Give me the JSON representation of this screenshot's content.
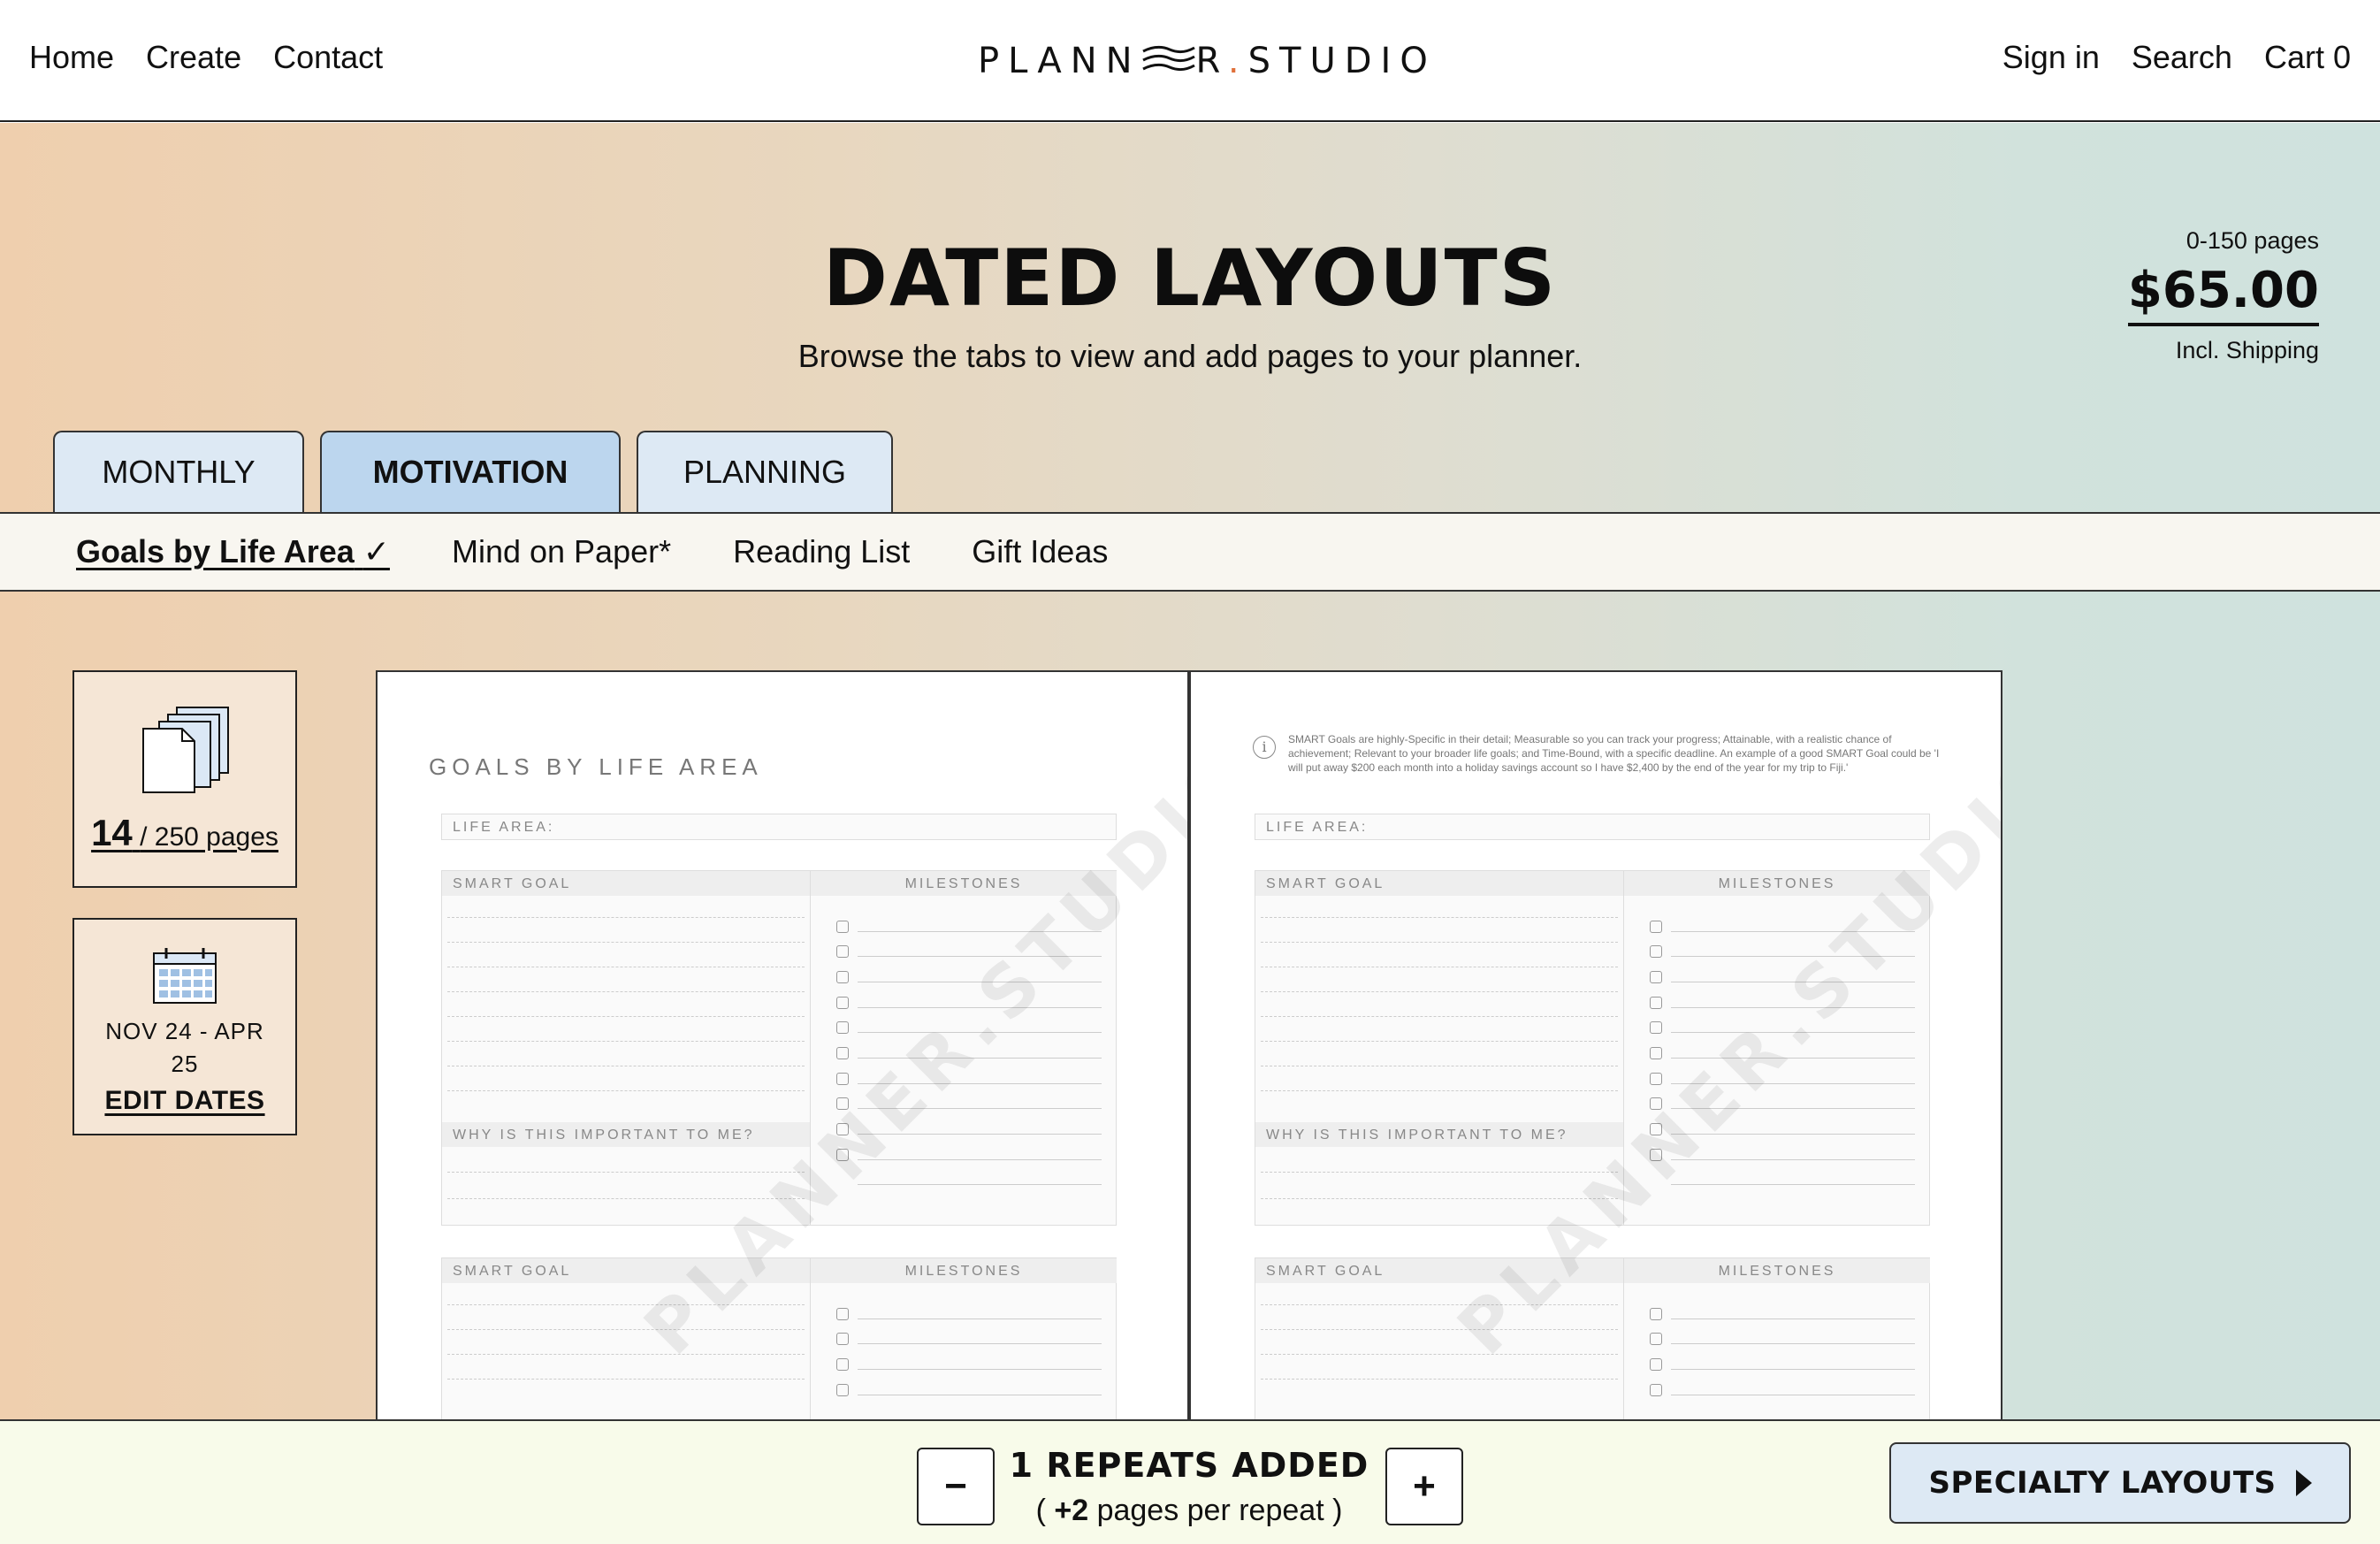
{
  "header": {
    "nav_left": [
      "Home",
      "Create",
      "Contact"
    ],
    "logo": {
      "part1": "PLANN",
      "part2": "R",
      "dot": ".",
      "part3": "STUDIO"
    },
    "nav_right": [
      "Sign in",
      "Search",
      "Cart 0"
    ]
  },
  "hero": {
    "title": "DATED LAYOUTS",
    "subtitle": "Browse the tabs to view and add pages to your planner."
  },
  "pricing": {
    "range": "0-150 pages",
    "price": "$65.00",
    "note": "Incl. Shipping"
  },
  "tabs": [
    {
      "label": "MONTHLY",
      "active": false
    },
    {
      "label": "MOTIVATION",
      "active": true
    },
    {
      "label": "PLANNING",
      "active": false
    }
  ],
  "subtabs": [
    {
      "label": "Goals by Life Area",
      "check": "✓",
      "active": true
    },
    {
      "label": "Mind on Paper*",
      "active": false
    },
    {
      "label": "Reading List",
      "active": false
    },
    {
      "label": "Gift Ideas",
      "active": false
    }
  ],
  "page_counter": {
    "count": "14",
    "total": "/ 250 pages"
  },
  "dates": {
    "range": "NOV 24 - APR 25",
    "edit_label": "EDIT DATES"
  },
  "preview": {
    "left": {
      "heading": "GOALS BY LIFE AREA",
      "life_area": "LIFE AREA:",
      "smart_goal": "SMART GOAL",
      "milestones": "MILESTONES",
      "why": "WHY IS THIS IMPORTANT TO ME?",
      "watermark": "PLANNER.STUDIO"
    },
    "right": {
      "info": "SMART Goals are highly-Specific in their detail; Measurable so you can track your progress; Attainable, with a realistic chance of achievement; Relevant to your broader life goals; and Time-Bound, with a specific deadline. An example of a good SMART Goal could be 'I will put away $200 each month into a holiday savings account so I have $2,400 by the end of the year for my trip to Fiji.'",
      "life_area": "LIFE AREA:",
      "smart_goal": "SMART GOAL",
      "milestones": "MILESTONES",
      "why": "WHY IS THIS IMPORTANT TO ME?",
      "watermark": "PLANNER.STUDIO"
    }
  },
  "bottom": {
    "minus": "−",
    "plus": "+",
    "repeats": "1 REPEATS ADDED",
    "pages_open": "(",
    "pages_value": "+2",
    "pages_text": "pages per repeat",
    "pages_close": ")",
    "specialty": "SPECIALTY LAYOUTS"
  },
  "icons": [
    "pages-stack-icon",
    "calendar-icon",
    "info-icon",
    "arrow-right-icon"
  ]
}
